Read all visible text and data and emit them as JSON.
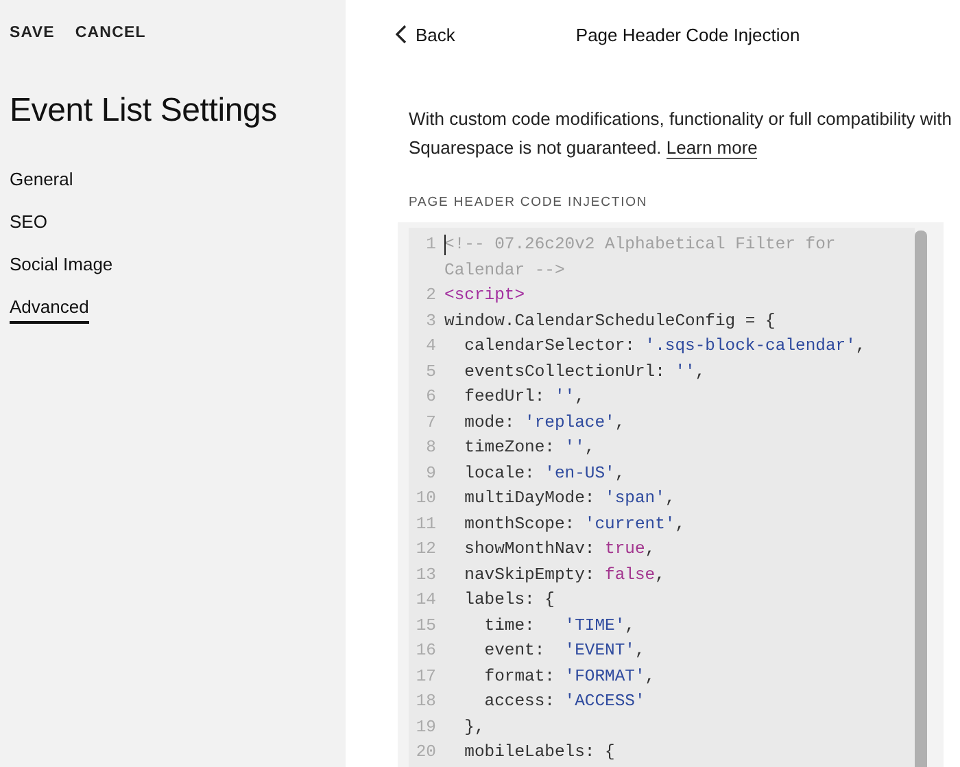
{
  "sidebar": {
    "actions": [
      "SAVE",
      "CANCEL"
    ],
    "title": "Event List Settings",
    "items": [
      {
        "label": "General",
        "selected": false
      },
      {
        "label": "SEO",
        "selected": false
      },
      {
        "label": "Social Image",
        "selected": false
      },
      {
        "label": "Advanced",
        "selected": true
      }
    ]
  },
  "panel": {
    "back": "Back",
    "title": "Page Header Code Injection",
    "notice": "With custom code modifications, functionality or full compatibility with Squarespace is not guaranteed.",
    "learn_more": "Learn more",
    "field_label": "PAGE HEADER CODE INJECTION",
    "code_lines": [
      {
        "number": "1",
        "tokens": [
          {
            "kind": "comment",
            "text": "<!-- 07.26c20v2 Alphabetical Filter for Calendar -->"
          }
        ]
      },
      {
        "number": "2",
        "tokens": [
          {
            "kind": "tag",
            "text": "<script>"
          }
        ]
      },
      {
        "number": "3",
        "tokens": [
          {
            "kind": "plain",
            "text": "window.CalendarScheduleConfig = {"
          }
        ]
      },
      {
        "number": "4",
        "tokens": [
          {
            "kind": "plain",
            "text": "  calendarSelector: "
          },
          {
            "kind": "string",
            "text": "'.sqs-block-calendar'"
          },
          {
            "kind": "plain",
            "text": ","
          }
        ]
      },
      {
        "number": "5",
        "tokens": [
          {
            "kind": "plain",
            "text": "  eventsCollectionUrl: "
          },
          {
            "kind": "string",
            "text": "''"
          },
          {
            "kind": "plain",
            "text": ","
          }
        ]
      },
      {
        "number": "6",
        "tokens": [
          {
            "kind": "plain",
            "text": "  feedUrl: "
          },
          {
            "kind": "string",
            "text": "''"
          },
          {
            "kind": "plain",
            "text": ","
          }
        ]
      },
      {
        "number": "7",
        "tokens": [
          {
            "kind": "plain",
            "text": "  mode: "
          },
          {
            "kind": "string",
            "text": "'replace'"
          },
          {
            "kind": "plain",
            "text": ","
          }
        ]
      },
      {
        "number": "8",
        "tokens": [
          {
            "kind": "plain",
            "text": "  timeZone: "
          },
          {
            "kind": "string",
            "text": "''"
          },
          {
            "kind": "plain",
            "text": ","
          }
        ]
      },
      {
        "number": "9",
        "tokens": [
          {
            "kind": "plain",
            "text": "  locale: "
          },
          {
            "kind": "string",
            "text": "'en-US'"
          },
          {
            "kind": "plain",
            "text": ","
          }
        ]
      },
      {
        "number": "10",
        "tokens": [
          {
            "kind": "plain",
            "text": "  multiDayMode: "
          },
          {
            "kind": "string",
            "text": "'span'"
          },
          {
            "kind": "plain",
            "text": ","
          }
        ]
      },
      {
        "number": "11",
        "tokens": [
          {
            "kind": "plain",
            "text": "  monthScope: "
          },
          {
            "kind": "string",
            "text": "'current'"
          },
          {
            "kind": "plain",
            "text": ","
          }
        ]
      },
      {
        "number": "12",
        "tokens": [
          {
            "kind": "plain",
            "text": "  showMonthNav: "
          },
          {
            "kind": "keyword",
            "text": "true"
          },
          {
            "kind": "plain",
            "text": ","
          }
        ]
      },
      {
        "number": "13",
        "tokens": [
          {
            "kind": "plain",
            "text": "  navSkipEmpty: "
          },
          {
            "kind": "keyword",
            "text": "false"
          },
          {
            "kind": "plain",
            "text": ","
          }
        ]
      },
      {
        "number": "14",
        "tokens": [
          {
            "kind": "plain",
            "text": "  labels: {"
          }
        ]
      },
      {
        "number": "15",
        "tokens": [
          {
            "kind": "plain",
            "text": "    time:   "
          },
          {
            "kind": "string",
            "text": "'TIME'"
          },
          {
            "kind": "plain",
            "text": ","
          }
        ]
      },
      {
        "number": "16",
        "tokens": [
          {
            "kind": "plain",
            "text": "    event:  "
          },
          {
            "kind": "string",
            "text": "'EVENT'"
          },
          {
            "kind": "plain",
            "text": ","
          }
        ]
      },
      {
        "number": "17",
        "tokens": [
          {
            "kind": "plain",
            "text": "    format: "
          },
          {
            "kind": "string",
            "text": "'FORMAT'"
          },
          {
            "kind": "plain",
            "text": ","
          }
        ]
      },
      {
        "number": "18",
        "tokens": [
          {
            "kind": "plain",
            "text": "    access: "
          },
          {
            "kind": "string",
            "text": "'ACCESS'"
          }
        ]
      },
      {
        "number": "19",
        "tokens": [
          {
            "kind": "plain",
            "text": "  },"
          }
        ]
      },
      {
        "number": "20",
        "tokens": [
          {
            "kind": "plain",
            "text": "  mobileLabels: {"
          }
        ]
      }
    ]
  }
}
